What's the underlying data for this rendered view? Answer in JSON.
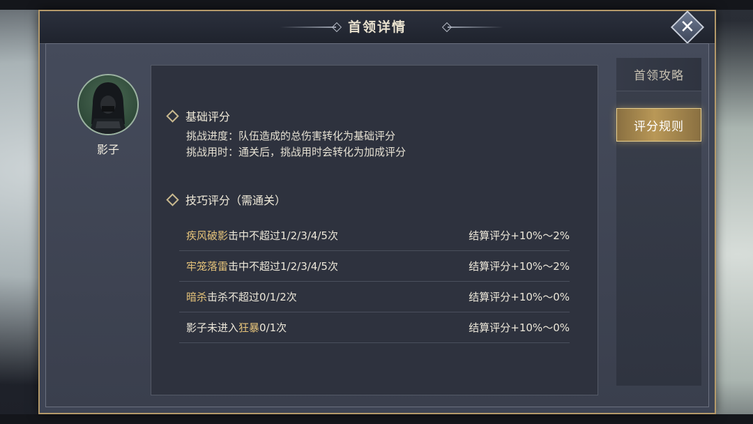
{
  "dialog": {
    "title": "首领详情",
    "close_icon": "close-x-icon"
  },
  "boss": {
    "name": "影子",
    "portrait_icon": "hooded-figure-portrait"
  },
  "tabs": [
    {
      "label": "首领攻略",
      "active": false
    },
    {
      "label": "评分规则",
      "active": true
    }
  ],
  "basic": {
    "title": "基础评分",
    "lines": [
      "挑战进度：队伍造成的总伤害转化为基础评分",
      "挑战用时：通关后，挑战用时会转化为加成评分"
    ]
  },
  "skill": {
    "title": "技巧评分（需通关）",
    "rows": [
      {
        "highlight": "疾风破影",
        "prefix": "",
        "text": "击中不超过1/2/3/4/5次",
        "reward": "结算评分+10%～2%"
      },
      {
        "highlight": "牢笼落雷",
        "prefix": "",
        "text": "击中不超过1/2/3/4/5次",
        "reward": "结算评分+10%～2%"
      },
      {
        "highlight": "暗杀",
        "prefix": "",
        "text": "击杀不超过0/1/2次",
        "reward": "结算评分+10%～0%"
      },
      {
        "highlight": "狂暴",
        "prefix": "影子未进入",
        "text": "0/1次",
        "reward": "结算评分+10%～0%"
      }
    ]
  },
  "colors": {
    "highlight": "#e5c37a",
    "frame_gold": "#b59a6a",
    "panel": "#2e323e"
  }
}
